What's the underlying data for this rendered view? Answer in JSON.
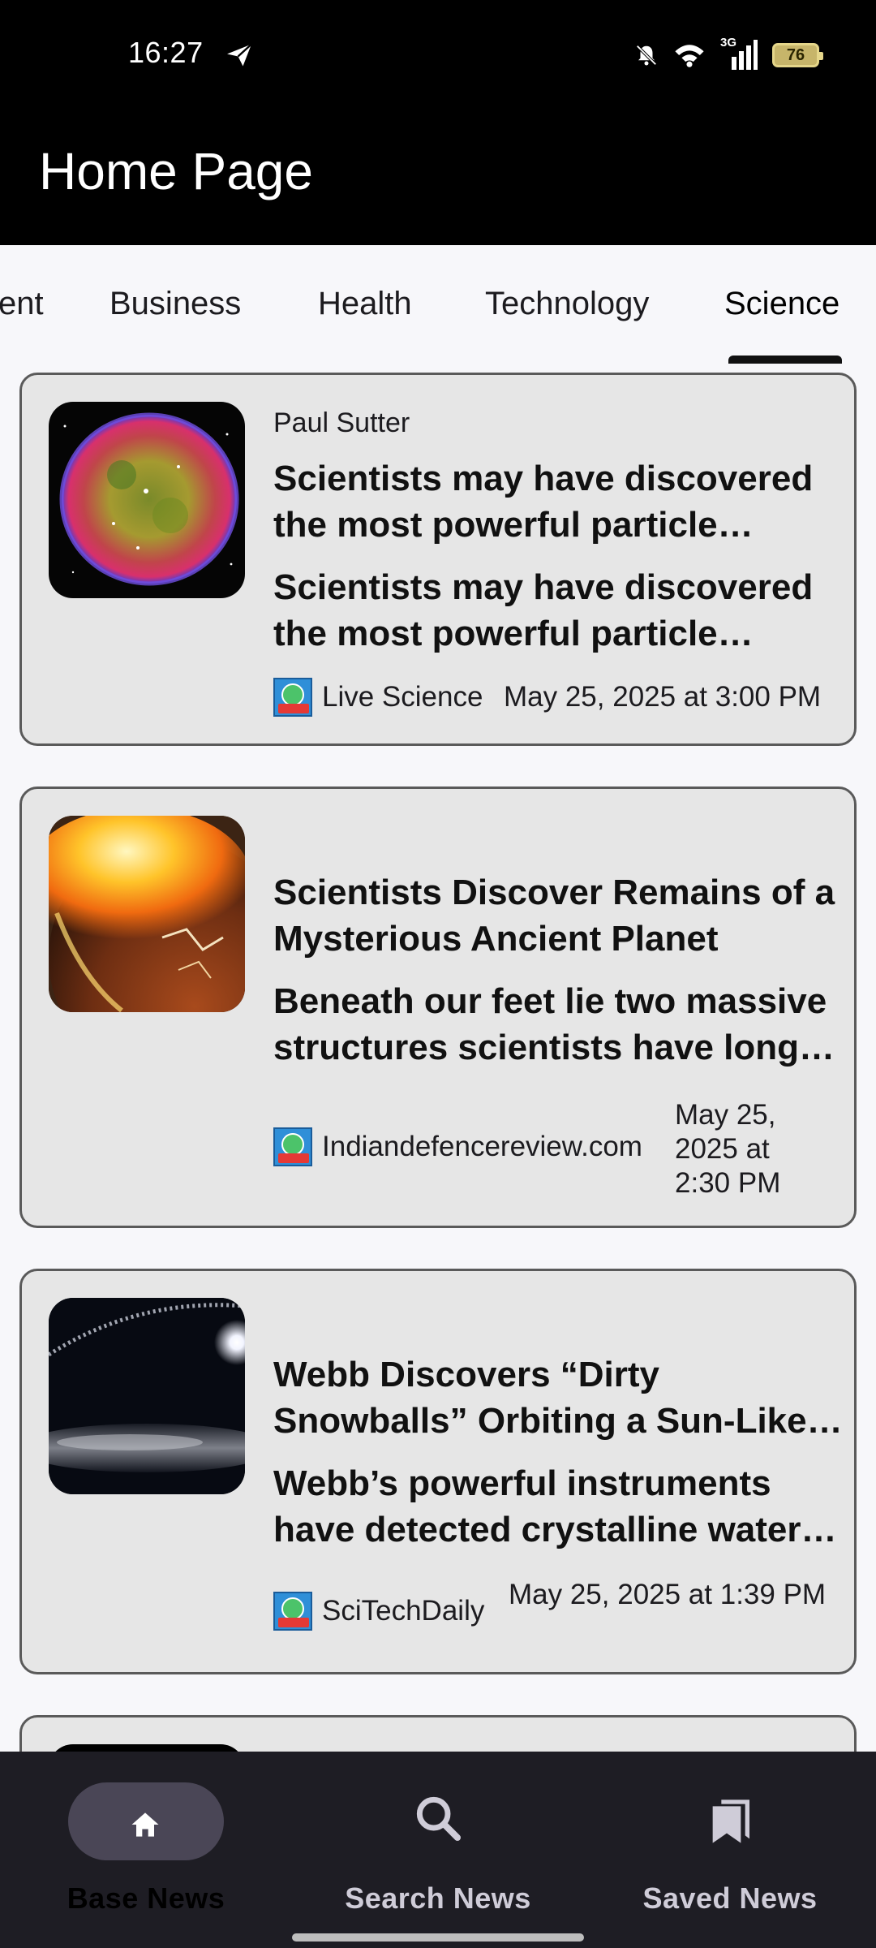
{
  "status_bar": {
    "time": "16:27",
    "network": "3G",
    "battery": "76",
    "icons": [
      "telegram-icon",
      "bell-off-icon",
      "wifi-icon",
      "signal-icon",
      "battery-icon"
    ]
  },
  "app_bar": {
    "title": "Home Page"
  },
  "tabs": [
    {
      "label": "ent",
      "active": false
    },
    {
      "label": "Business",
      "active": false
    },
    {
      "label": "Health",
      "active": false
    },
    {
      "label": "Technology",
      "active": false
    },
    {
      "label": "Science",
      "active": true
    }
  ],
  "articles": [
    {
      "author": "Paul Sutter",
      "title": "Scientists may have discovered the most powerful particle collider in the galaxy",
      "description": "Scientists may have discovered the most powerful particle collider in the galaxy",
      "source": "Live Science",
      "date": "May 25, 2025 at 3:00 PM",
      "image": "supernova-remnant"
    },
    {
      "author": "",
      "title": "Scientists Discover Remains of a Mysterious Ancient Planet",
      "description": "Beneath our feet lie two massive structures scientists have long puzzled over",
      "source": "Indiandefencereview.com",
      "date": "May 25, 2025 at 2:30 PM",
      "image": "planet-collision"
    },
    {
      "author": "",
      "title": "Webb Discovers “Dirty Snowballs” Orbiting a Sun-Like Star",
      "description": "Webb’s powerful instruments have detected crystalline water ice",
      "source": "SciTechDaily",
      "date": "May 25, 2025 at 1:39 PM",
      "image": "debris-disk"
    }
  ],
  "bottom_nav": [
    {
      "label": "Base News",
      "icon": "home-icon",
      "active": true
    },
    {
      "label": "Search News",
      "icon": "search-icon",
      "active": false
    },
    {
      "label": "Saved News",
      "icon": "bookmarks-icon",
      "active": false
    }
  ],
  "colors": {
    "app_bar": "#000000",
    "card_bg": "#e6e6e6",
    "nav_bg": "#1e1d24",
    "nav_pill": "#4a4656"
  }
}
